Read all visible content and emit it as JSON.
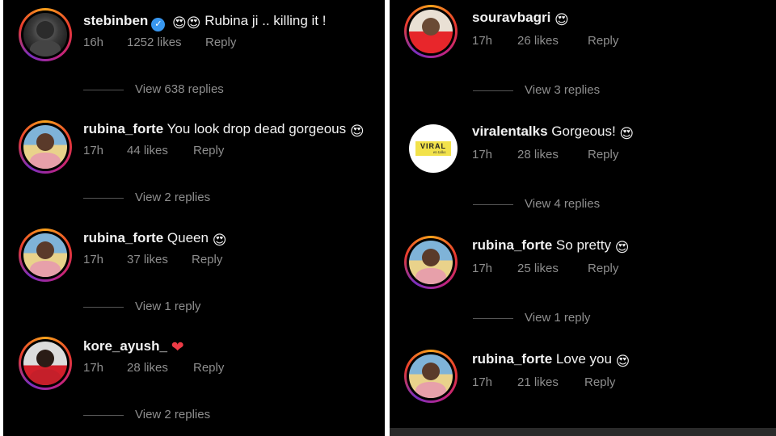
{
  "left": {
    "comments": [
      {
        "username": "stebinben",
        "verified": true,
        "text": "Rubina ji .. killing it !",
        "emoji_prefix": "😍😍",
        "emoji_suffix": "",
        "time": "16h",
        "likes": "1252 likes",
        "reply": "Reply",
        "view_replies": "View 638 replies",
        "avatar": "dark"
      },
      {
        "username": "rubina_forte",
        "verified": false,
        "text": "You look drop dead gorgeous",
        "emoji_prefix": "",
        "emoji_suffix": "😍",
        "time": "17h",
        "likes": "44 likes",
        "reply": "Reply",
        "view_replies": "View 2 replies",
        "avatar": "beach"
      },
      {
        "username": "rubina_forte",
        "verified": false,
        "text": "Queen",
        "emoji_prefix": "",
        "emoji_suffix": "😍",
        "time": "17h",
        "likes": "37 likes",
        "reply": "Reply",
        "view_replies": "View 1 reply",
        "avatar": "beach"
      },
      {
        "username": "kore_ayush_",
        "verified": false,
        "text": "",
        "emoji_prefix": "",
        "emoji_suffix": "❤",
        "time": "17h",
        "likes": "28 likes",
        "reply": "Reply",
        "view_replies": "View 2 replies",
        "avatar": "girl-red"
      }
    ]
  },
  "right": {
    "comments": [
      {
        "username": "souravbagri",
        "verified": false,
        "text": "",
        "emoji_prefix": "",
        "emoji_suffix": "😍",
        "time": "17h",
        "likes": "26 likes",
        "reply": "Reply",
        "view_replies": "View 3 replies",
        "avatar": "red"
      },
      {
        "username": "viralentalks",
        "verified": false,
        "text": "Gorgeous!",
        "emoji_prefix": "",
        "emoji_suffix": "😍",
        "time": "17h",
        "likes": "28 likes",
        "reply": "Reply",
        "view_replies": "View 4 replies",
        "avatar": "logo"
      },
      {
        "username": "rubina_forte",
        "verified": false,
        "text": "So pretty",
        "emoji_prefix": "",
        "emoji_suffix": "😍",
        "time": "17h",
        "likes": "25 likes",
        "reply": "Reply",
        "view_replies": "View 1 reply",
        "avatar": "beach"
      },
      {
        "username": "rubina_forte",
        "verified": false,
        "text": "Love you",
        "emoji_prefix": "",
        "emoji_suffix": "😍",
        "time": "17h",
        "likes": "21 likes",
        "reply": "Reply",
        "view_replies": "",
        "avatar": "beach"
      }
    ],
    "logo_text": "VIRAL",
    "logo_sub": "en talks"
  },
  "colors": {
    "background": "#000000",
    "text_primary": "#f2f2f2",
    "text_secondary": "#8e8e8e",
    "verified_blue": "#3897f0",
    "heart_red": "#ed3b46"
  }
}
